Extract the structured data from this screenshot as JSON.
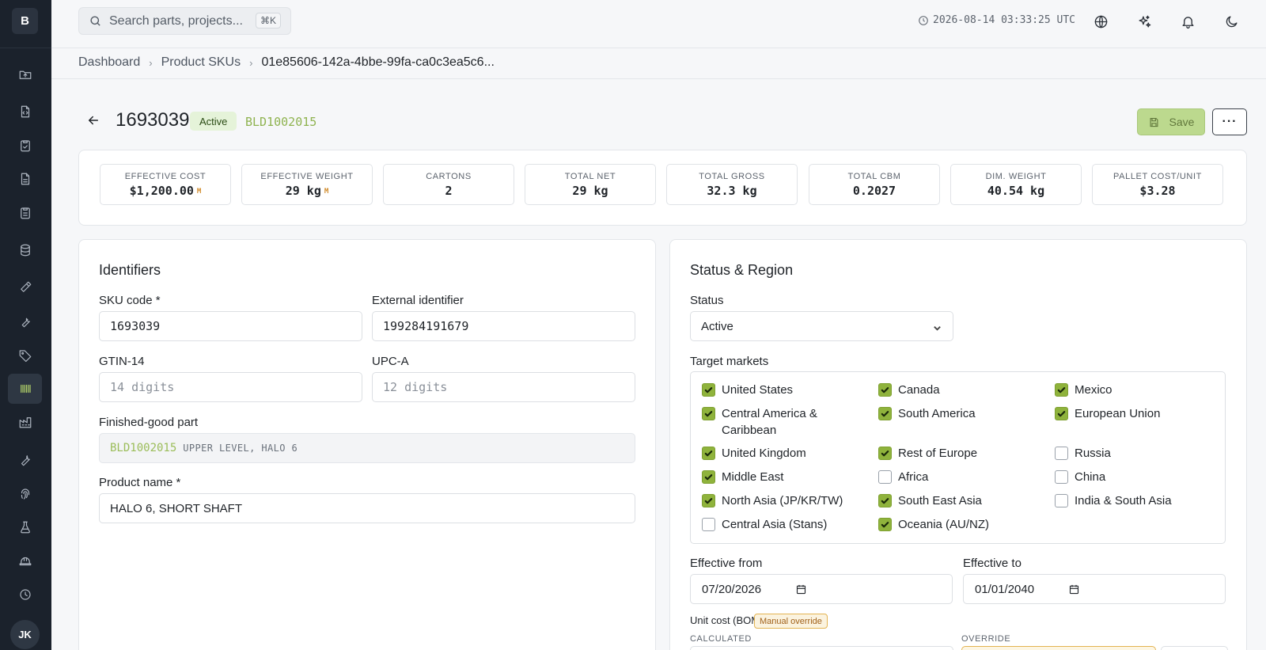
{
  "app": {
    "logo": "B",
    "user_initials": "JK"
  },
  "sidebar": {
    "items": [
      {
        "icon": "folder-upload-icon"
      },
      {
        "icon": "file-code-icon"
      },
      {
        "icon": "clipboard-check-icon"
      },
      {
        "icon": "file-text-icon"
      },
      {
        "icon": "clipboard-list-icon"
      },
      {
        "icon": "database-icon"
      },
      {
        "icon": "hammer-icon"
      },
      {
        "icon": "wrench-icon"
      },
      {
        "icon": "tag-icon"
      },
      {
        "icon": "barcode-icon",
        "active": true
      },
      {
        "icon": "factory-icon"
      },
      {
        "icon": "tool-icon"
      },
      {
        "icon": "fingerprint-icon"
      },
      {
        "icon": "flask-icon"
      },
      {
        "icon": "hard-hat-icon"
      },
      {
        "icon": "clock-icon"
      }
    ]
  },
  "topbar": {
    "search_placeholder": "Search parts, projects...",
    "search_shortcut": "⌘K",
    "timestamp": "2026-08-14 03:33:25 UTC"
  },
  "breadcrumb": {
    "items": [
      "Dashboard",
      "Product SKUs"
    ],
    "current": "01e85606-142a-4bbe-99fa-ca0c3ea5c6..."
  },
  "header": {
    "sku": "1693039",
    "status": "Active",
    "part_code": "BLD1002015",
    "save_label": "Save",
    "more_label": "···"
  },
  "metrics": [
    {
      "label": "Effective cost",
      "value": "$1,200.00",
      "marker": "M"
    },
    {
      "label": "Effective weight",
      "value": "29 kg",
      "marker": "M"
    },
    {
      "label": "Cartons",
      "value": "2"
    },
    {
      "label": "Total net",
      "value": "29 kg"
    },
    {
      "label": "Total gross",
      "value": "32.3 kg"
    },
    {
      "label": "Total CBM",
      "value": "0.2027"
    },
    {
      "label": "Dim. weight",
      "value": "40.54 kg"
    },
    {
      "label": "Pallet cost/unit",
      "value": "$3.28"
    }
  ],
  "identifiers": {
    "title": "Identifiers",
    "sku_code_label": "SKU code *",
    "sku_code_value": "1693039",
    "external_label": "External identifier",
    "external_value": "199284191679",
    "gtin_label": "GTIN-14",
    "gtin_placeholder": "14 digits",
    "upc_label": "UPC-A",
    "upc_placeholder": "12 digits",
    "finished_label": "Finished-good part",
    "finished_code": "BLD1002015",
    "finished_name": "UPPER LEVEL, HALO 6",
    "product_name_label": "Product name *",
    "product_name_value": "HALO 6, SHORT SHAFT"
  },
  "status_region": {
    "title": "Status & Region",
    "status_label": "Status",
    "status_value": "Active",
    "markets_label": "Target markets",
    "markets": [
      {
        "name": "United States",
        "checked": true
      },
      {
        "name": "Canada",
        "checked": true
      },
      {
        "name": "Mexico",
        "checked": true
      },
      {
        "name": "Central America & Caribbean",
        "checked": true
      },
      {
        "name": "South America",
        "checked": true
      },
      {
        "name": "European Union",
        "checked": true
      },
      {
        "name": "United Kingdom",
        "checked": true
      },
      {
        "name": "Rest of Europe",
        "checked": true
      },
      {
        "name": "Russia",
        "checked": false
      },
      {
        "name": "Middle East",
        "checked": true
      },
      {
        "name": "Africa",
        "checked": false
      },
      {
        "name": "China",
        "checked": false
      },
      {
        "name": "North Asia (JP/KR/TW)",
        "checked": true
      },
      {
        "name": "South East Asia",
        "checked": true
      },
      {
        "name": "India & South Asia",
        "checked": false
      },
      {
        "name": "Central Asia (Stans)",
        "checked": false
      },
      {
        "name": "Oceania (AU/NZ)",
        "checked": true
      }
    ],
    "effective_from_label": "Effective from",
    "effective_from_value": "07/20/2026",
    "effective_to_label": "Effective to",
    "effective_to_value": "01/01/2040",
    "unit_cost_label": "Unit cost (BOM)",
    "override_badge": "Manual override",
    "calculated_label": "Calculated",
    "override_label": "Override"
  }
}
